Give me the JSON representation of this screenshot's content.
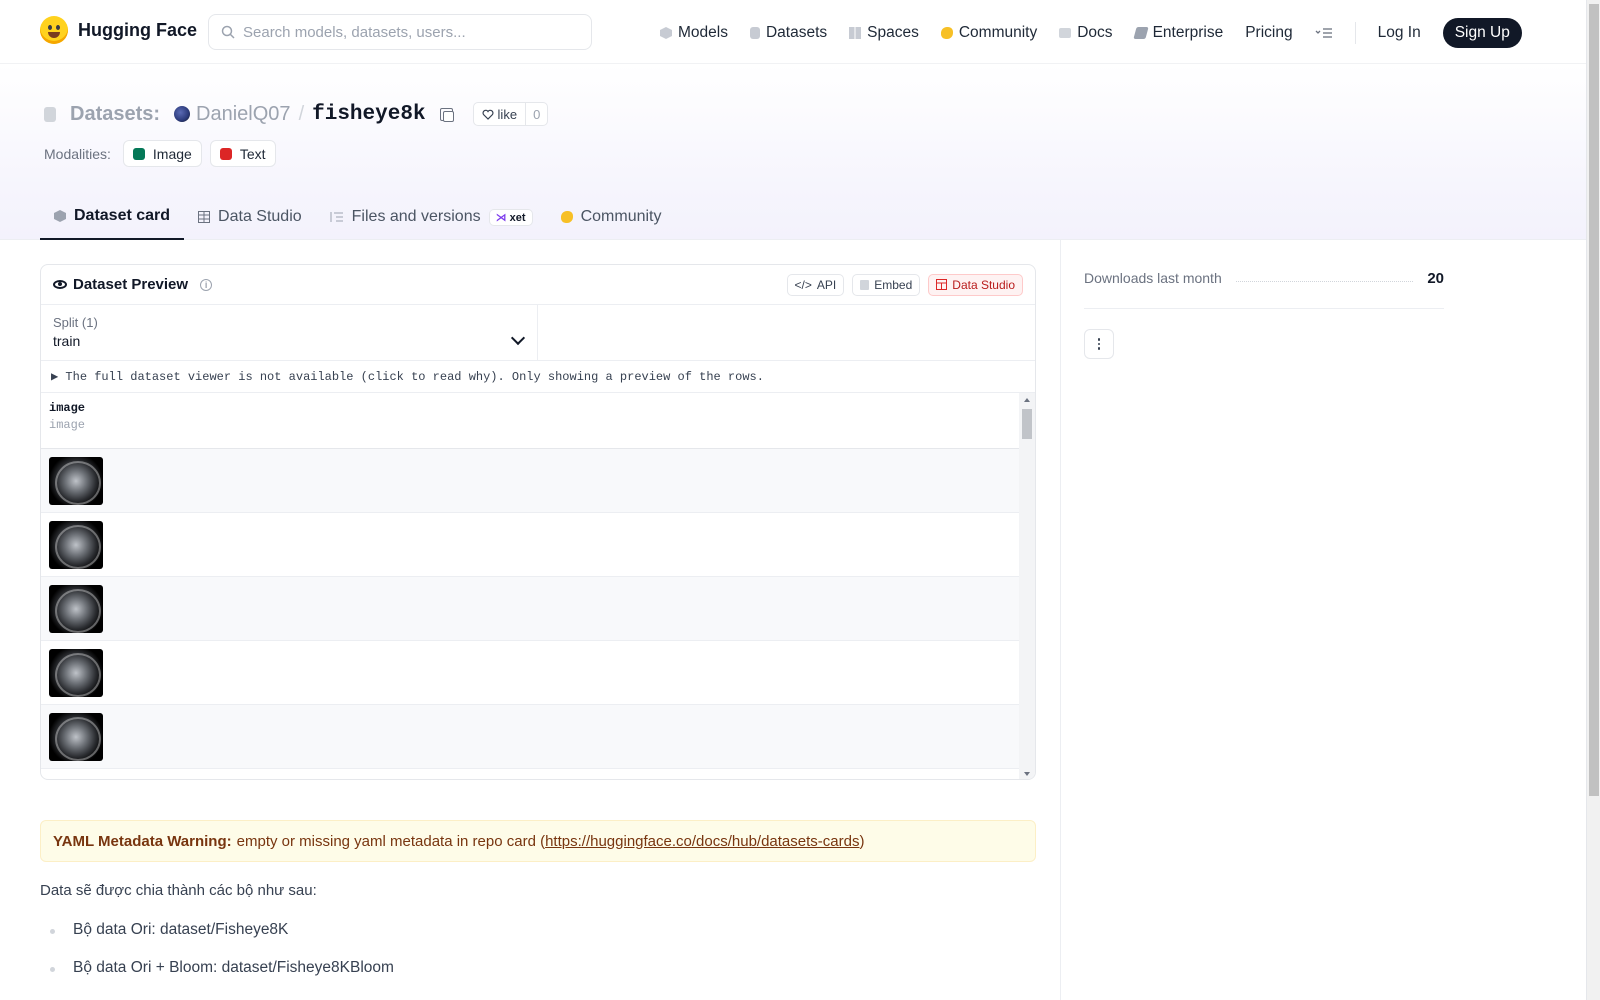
{
  "nav": {
    "brand": "Hugging Face",
    "search_placeholder": "Search models, datasets, users...",
    "links": [
      {
        "label": "Models",
        "icon": "models-icon"
      },
      {
        "label": "Datasets",
        "icon": "datasets-icon"
      },
      {
        "label": "Spaces",
        "icon": "spaces-icon"
      },
      {
        "label": "Community",
        "icon": "community-icon"
      },
      {
        "label": "Docs",
        "icon": "docs-icon"
      },
      {
        "label": "Enterprise",
        "icon": "enterprise-icon"
      },
      {
        "label": "Pricing"
      }
    ],
    "login": "Log In",
    "signup": "Sign Up"
  },
  "header": {
    "section": "Datasets:",
    "owner": "DanielQ07",
    "repo": "fisheye8k",
    "like_label": "like",
    "like_count": "0",
    "modalities_label": "Modalities:",
    "modalities": [
      {
        "label": "Image",
        "color": "#047857"
      },
      {
        "label": "Text",
        "color": "#dc2626"
      }
    ],
    "tabs": [
      {
        "label": "Dataset card",
        "active": true
      },
      {
        "label": "Data Studio"
      },
      {
        "label": "Files and versions",
        "badge": "xet"
      },
      {
        "label": "Community"
      }
    ]
  },
  "preview": {
    "title": "Dataset Preview",
    "actions": [
      "API",
      "Embed",
      "Data Studio"
    ],
    "split_label": "Split (1)",
    "split_value": "train",
    "notice": "▶ The full dataset viewer is not available (click to read why). Only showing a preview of the rows.",
    "column_name": "image",
    "column_type": "image",
    "row_count_visible": 5
  },
  "card": {
    "yaml_warning_title": "YAML Metadata Warning:",
    "yaml_warning_text": "empty or missing yaml metadata in repo card (",
    "yaml_warning_link": "https://huggingface.co/docs/hub/datasets-cards",
    "yaml_warning_end": ")",
    "intro": "Data sẽ được chia thành các bộ như sau:",
    "bullets": [
      "Bộ data Ori: dataset/Fisheye8K",
      "Bộ data Ori + Bloom: dataset/Fisheye8KBloom"
    ]
  },
  "sidebar": {
    "downloads_label": "Downloads last month",
    "downloads_value": "20"
  }
}
